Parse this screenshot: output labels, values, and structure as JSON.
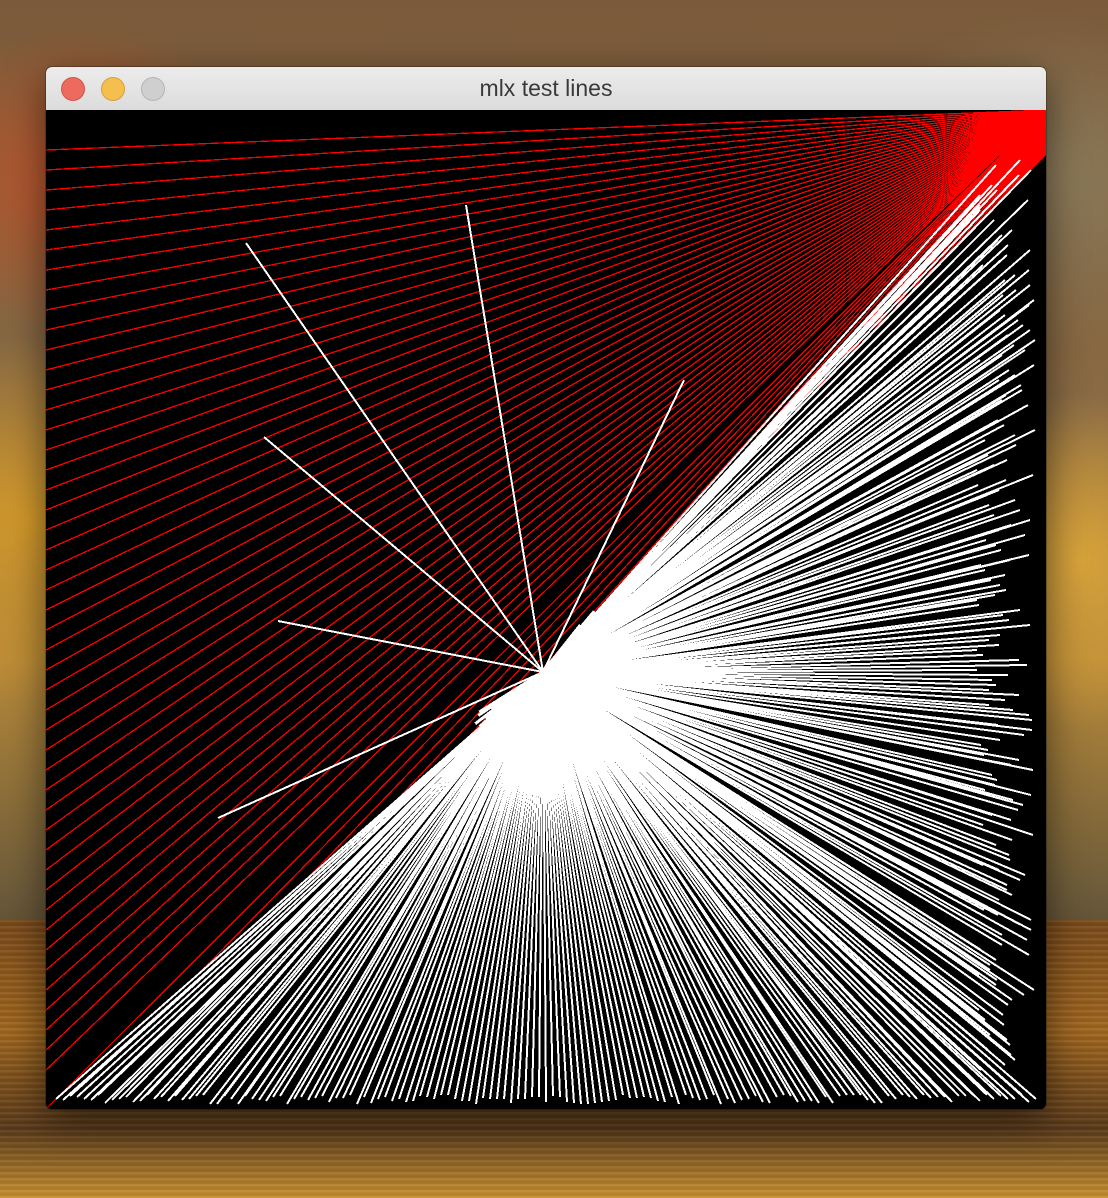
{
  "window": {
    "title": "mlx test lines",
    "buttons": {
      "close": "close-button",
      "minimize": "minimize-button",
      "zoom": "zoom-button"
    }
  },
  "colors": {
    "canvas_background": "#000000",
    "line_red": "#ff0000",
    "line_white": "#ffffff",
    "close": "#ec6a5e",
    "minimize": "#f4bf4f",
    "zoom": "#cfcfcf"
  }
}
